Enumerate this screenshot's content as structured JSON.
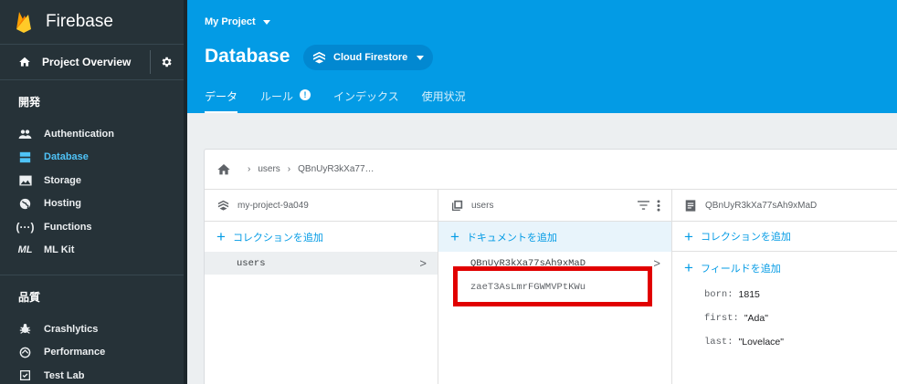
{
  "sidebar": {
    "brand": "Firebase",
    "overview_label": "Project Overview",
    "section_develop": "開発",
    "develop_items": [
      {
        "label": "Authentication",
        "icon": "people-icon"
      },
      {
        "label": "Database",
        "icon": "database-icon",
        "active": true
      },
      {
        "label": "Storage",
        "icon": "image-icon"
      },
      {
        "label": "Hosting",
        "icon": "globe-icon"
      },
      {
        "label": "Functions",
        "icon": "functions-icon"
      },
      {
        "label": "ML Kit",
        "icon": "ml-kit-icon"
      }
    ],
    "section_quality": "品質",
    "quality_items": [
      {
        "label": "Crashlytics",
        "icon": "crashlytics-icon"
      },
      {
        "label": "Performance",
        "icon": "performance-icon"
      },
      {
        "label": "Test Lab",
        "icon": "test-lab-icon"
      }
    ]
  },
  "header": {
    "project_name": "My Project",
    "page_title": "Database",
    "db_selector": "Cloud Firestore",
    "tabs": [
      {
        "label": "データ",
        "active": true
      },
      {
        "label": "ルール",
        "badge": "!"
      },
      {
        "label": "インデックス"
      },
      {
        "label": "使用状況"
      }
    ]
  },
  "breadcrumb": {
    "items": [
      "users",
      "QBnUyR3kXa77…"
    ]
  },
  "columns": {
    "project": {
      "title": "my-project-9a049",
      "add_label": "コレクションを追加",
      "collections": [
        "users"
      ]
    },
    "collection": {
      "title": "users",
      "add_label": "ドキュメントを追加",
      "documents": [
        "QBnUyR3kXa77sAh9xMaD",
        "zaeT3AsLmrFGWMVPtKWu"
      ]
    },
    "document": {
      "title": "QBnUyR3kXa77sAh9xMaD",
      "add_collection_label": "コレクションを追加",
      "add_field_label": "フィールドを追加",
      "fields": [
        {
          "key": "born:",
          "value": "1815"
        },
        {
          "key": "first:",
          "value": "\"Ada\""
        },
        {
          "key": "last:",
          "value": "\"Lovelace\""
        }
      ]
    }
  },
  "colors": {
    "header_blue": "#039be5",
    "sidebar_dark": "#263238",
    "accent_link": "#039be5",
    "highlight_red": "#e10000"
  }
}
